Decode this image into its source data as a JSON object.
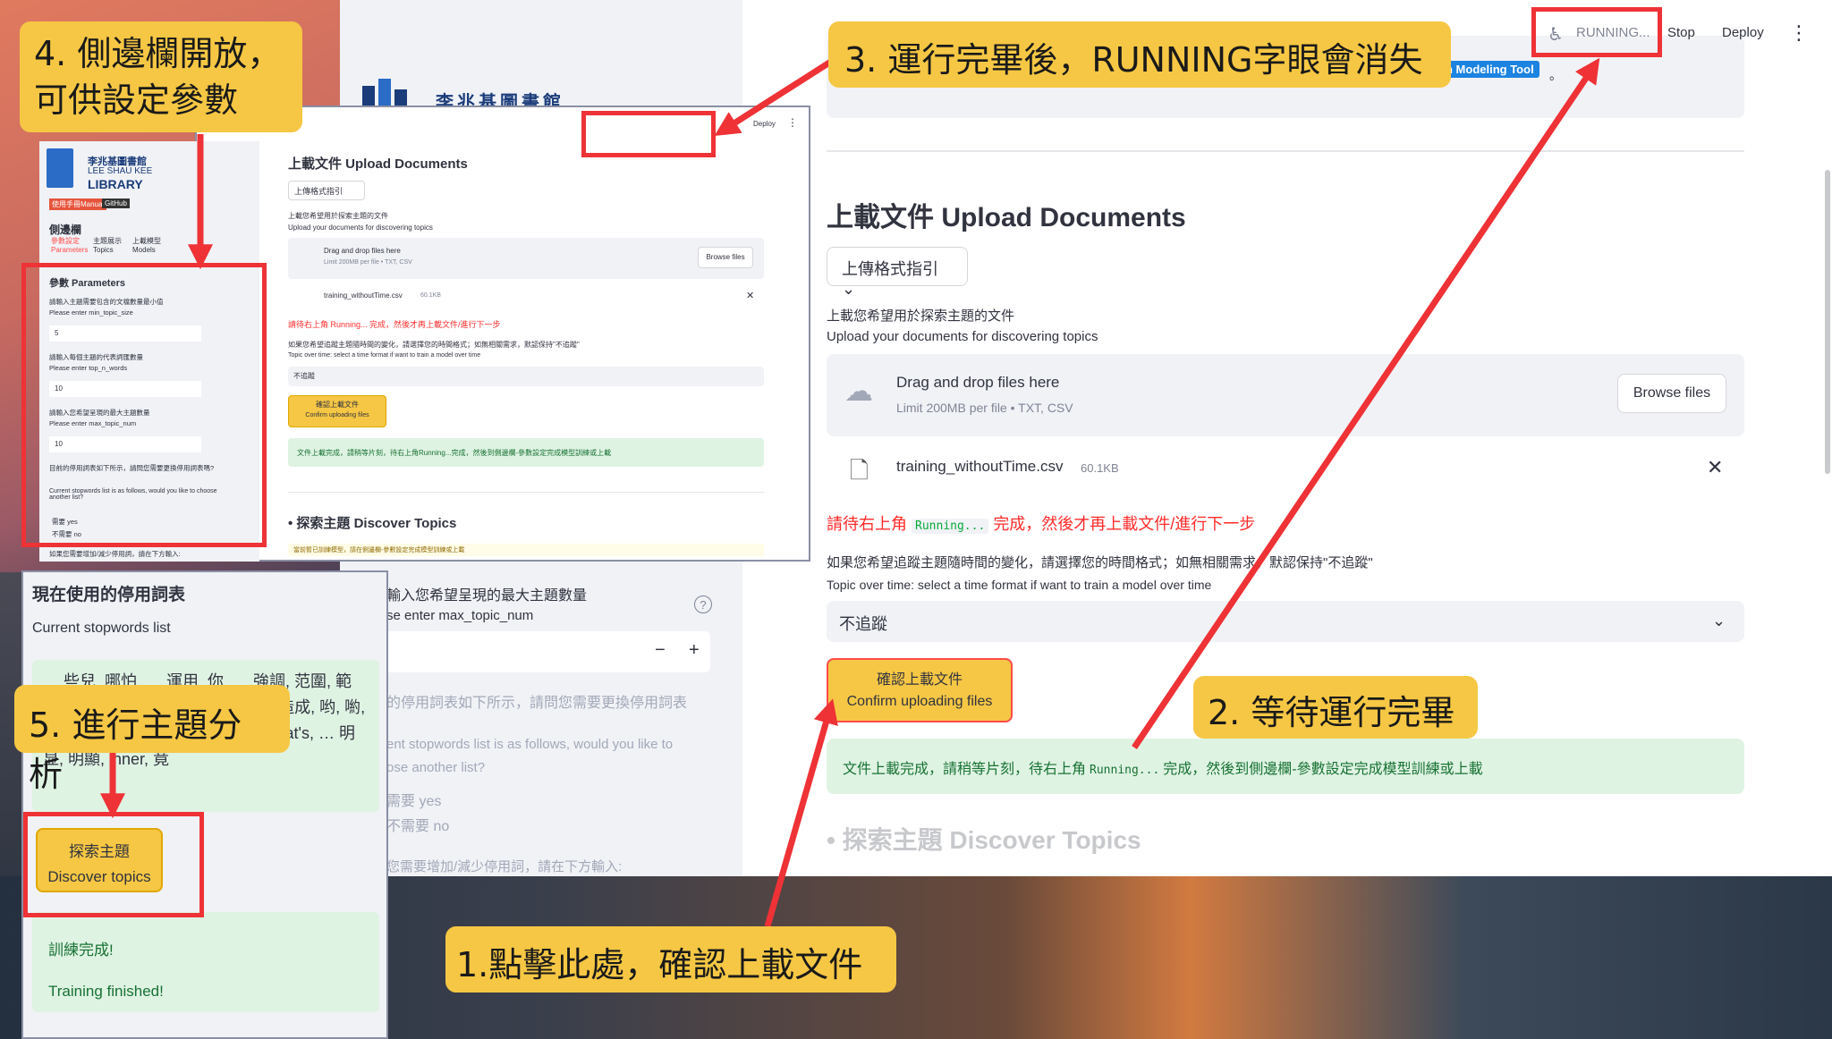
{
  "main": {
    "library_name": "李兆基圖書館",
    "running_label": "RUNNING...",
    "stop_label": "Stop",
    "deploy_label": "Deploy",
    "menu_glyph": "⋮",
    "tool_tag": "h Modeling Tool",
    "tool_tag_suffix": "。",
    "upload_title": "上載文件 Upload Documents",
    "format_guide": "上傳格式指引",
    "upload_desc_zh": "上載您希望用於探索主題的文件",
    "upload_desc_en": "Upload your documents for discovering topics",
    "drop_title": "Drag and drop files here",
    "drop_limit": "Limit 200MB per file • TXT, CSV",
    "browse_label": "Browse files",
    "file_name": "training_withoutTime.csv",
    "file_size": "60.1KB",
    "red_note_prefix": "請待右上角",
    "red_note_code": "Running...",
    "red_note_suffix": "完成，然後才再上載文件/進行下一步",
    "time_desc_zh": "如果您希望追蹤主題隨時間的變化，請選擇您的時間格式；如無相關需求，默認保持\"不追蹤\"",
    "time_desc_en": "Topic over time: select a time format if want to train a model over time",
    "time_select_value": "不追蹤",
    "confirm_zh": "確認上載文件",
    "confirm_en": "Confirm uploading files",
    "success_prefix": "文件上載完成，請稍等片刻，待右上角",
    "success_code": "Running...",
    "success_suffix": "完成，然後到側邊欄-參數設定完成模型訓練或上載",
    "discover_title": "• 探索主題 Discover Topics"
  },
  "inset1": {
    "lib_zh": "李兆基圖書館",
    "lib_en1": "LEE SHAU KEE",
    "lib_en2": "LIBRARY",
    "badge_manual": "使用手冊Manual",
    "badge_github": "GitHub",
    "sidebar_title": "側邊欄",
    "tabs": [
      "參數設定",
      "主題展示",
      "上載模型"
    ],
    "tabs_en": [
      "Parameters",
      "Topics",
      "Models"
    ],
    "param_title": "參數 Parameters",
    "q1_zh": "請輸入主題需要包含的文檔數量最小值",
    "q1_en": "Please enter min_topic_size",
    "q1_val": "5",
    "q2_zh": "請輸入每個主題的代表詞匯數量",
    "q2_en": "Please enter top_n_words",
    "q2_val": "10",
    "q3_zh": "請輸入您希望呈現的最大主題數量",
    "q3_en": "Please enter max_topic_num",
    "q3_val": "10",
    "stop_q_zh": "目前的停用詞表如下所示，請問您需要更換停用詞表嗎?",
    "stop_q_en": "Current stopwords list is as follows, would you like to choose another list?",
    "opt_yes": "需要 yes",
    "opt_no": "不需要 no",
    "bottom_cut": "如果您需要增加/減少停用詞，請在下方輸入:",
    "content_title": "上載文件 Upload Documents",
    "format_guide": "上傳格式指引",
    "desc_zh": "上載您希望用於探索主題的文件",
    "desc_en": "Upload your documents for discovering topics",
    "drop_title": "Drag and drop files here",
    "drop_limit": "Limit 200MB per file • TXT, CSV",
    "browse": "Browse files",
    "file_name": "training_withoutTime.csv",
    "file_size": "60.1KB",
    "red_note": "請待右上角 Running... 完成，然後才再上載文件/進行下一步",
    "time_zh": "如果您希望追蹤主題隨時間的變化，請選擇您的時間格式；如無相關需求，默認保持\"不追蹤\"",
    "time_en": "Topic over time: select a time format if want to train a model over time",
    "time_val": "不追蹤",
    "confirm_zh": "確認上載文件",
    "confirm_en": "Confirm uploading files",
    "success": "文件上載完成，請稍等片刻，待右上角Running...完成，然後到側邊欄-參數設定完成模型訓練或上載",
    "discover": "• 探索主題 Discover Topics",
    "warn_cut": "當前暫已訓練模型，請在側邊欄-參數設定完成模型訓練或上載",
    "deploy": "Deploy"
  },
  "inset2": {
    "title": "現在使用的停用詞表",
    "subtitle": "Current stopwords list",
    "words": "… 些兒, 哪怕, … 運用, 你, … 強調, 范圍, 範圍, 省得, nothing, 嘎登, 倘, 在下, 造成, 哟, 喲, 則甚, twice, 部分, new, 矣, he's, that's, … 明显, 明顯, inner, 竟",
    "discover_zh": "探索主題",
    "discover_en": "Discover topics",
    "done_zh": "訓練完成!",
    "done_en": "Training finished!"
  },
  "fragments": {
    "max_topic_q": "輸入您希望呈現的最大主題數量",
    "max_topic_en": "se enter max_topic_num",
    "minus": "−",
    "plus": "+",
    "stop_q": "的停用詞表如下所示，請問您需要更換停用詞表",
    "stop_en1": "ent stopwords list is as follows, would you like to",
    "stop_en2": "ose another list?",
    "yes": "需要 yes",
    "no": "不需要 no",
    "add_remove": "您需要增加/減少停用詞，請在下方輸入:"
  },
  "annotations": {
    "step1": "1.點擊此處，確認上載文件",
    "step2": "2. 等待運行完畢",
    "step3": "3. 運行完畢後，RUNNING字眼會消失",
    "step4_line1": "4. 側邊欄開放，",
    "step4_line2": "可供設定參數",
    "step5": "5. 進行主題分析"
  },
  "colors": {
    "callout": "#f6c744",
    "arrow_red": "#ee3236",
    "confirm_yellow": "#f6c744",
    "success_green": "#dff3e3",
    "error_red": "#ff2b2b"
  }
}
